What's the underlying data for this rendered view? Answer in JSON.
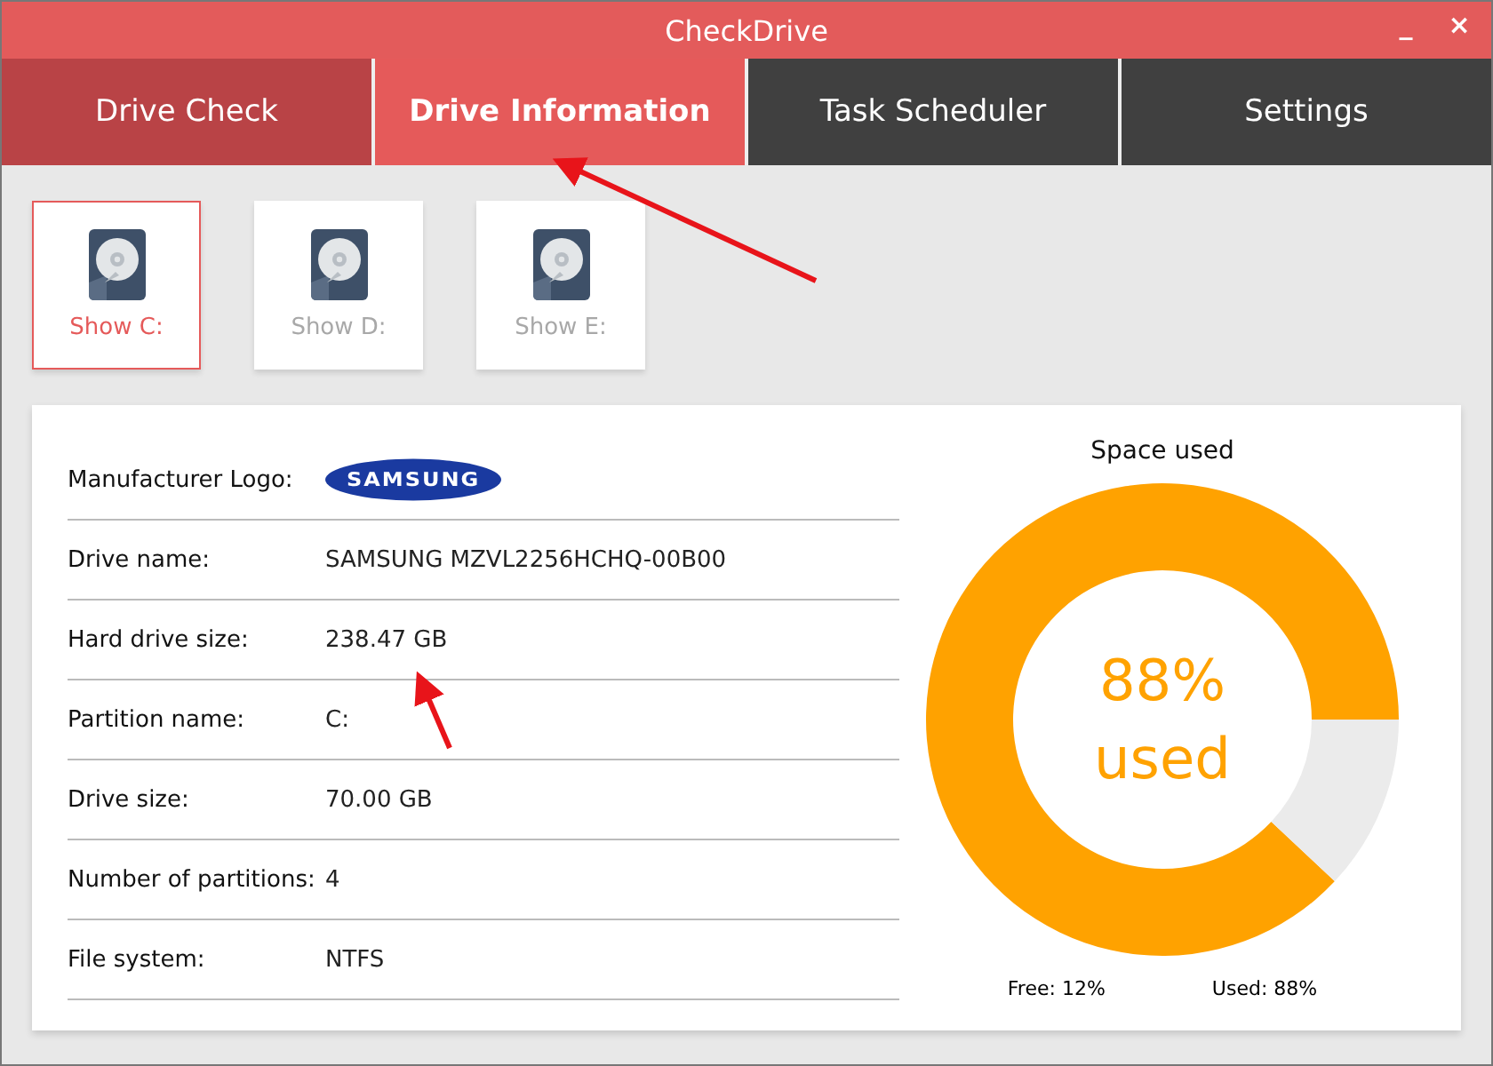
{
  "window": {
    "title": "CheckDrive",
    "controls": [
      "_",
      "×"
    ]
  },
  "tabs": [
    {
      "label": "Drive Check",
      "selected": false,
      "color": "#b94346"
    },
    {
      "label": "Drive Information",
      "selected": true,
      "color": "#e55a5a"
    },
    {
      "label": "Task Scheduler",
      "selected": false,
      "color": "#404040"
    },
    {
      "label": "Settings",
      "selected": false,
      "color": "#404040"
    }
  ],
  "drives": [
    {
      "label": "Show C:",
      "selected": true
    },
    {
      "label": "Show D:",
      "selected": false
    },
    {
      "label": "Show E:",
      "selected": false
    }
  ],
  "info": [
    {
      "kind": "logo",
      "label": "Manufacturer Logo:",
      "value": "SAMSUNG"
    },
    {
      "kind": "text",
      "label": "Drive name:",
      "value": "SAMSUNG MZVL2256HCHQ-00B00"
    },
    {
      "kind": "text",
      "label": "Hard drive size:",
      "value": "238.47 GB"
    },
    {
      "kind": "text",
      "label": "Partition name:",
      "value": "C:"
    },
    {
      "kind": "text",
      "label": "Drive size:",
      "value": "70.00 GB"
    },
    {
      "kind": "text",
      "label": "Number of partitions:",
      "value": "4"
    },
    {
      "kind": "text",
      "label": "File system:",
      "value": "NTFS"
    }
  ],
  "space": {
    "title": "Space used",
    "chart_data": {
      "type": "donut",
      "values": [
        88,
        12
      ]
    },
    "center_lines": [
      "88%",
      "used"
    ],
    "free_label": "Free: 12%",
    "used_label": "Used: 88%"
  }
}
